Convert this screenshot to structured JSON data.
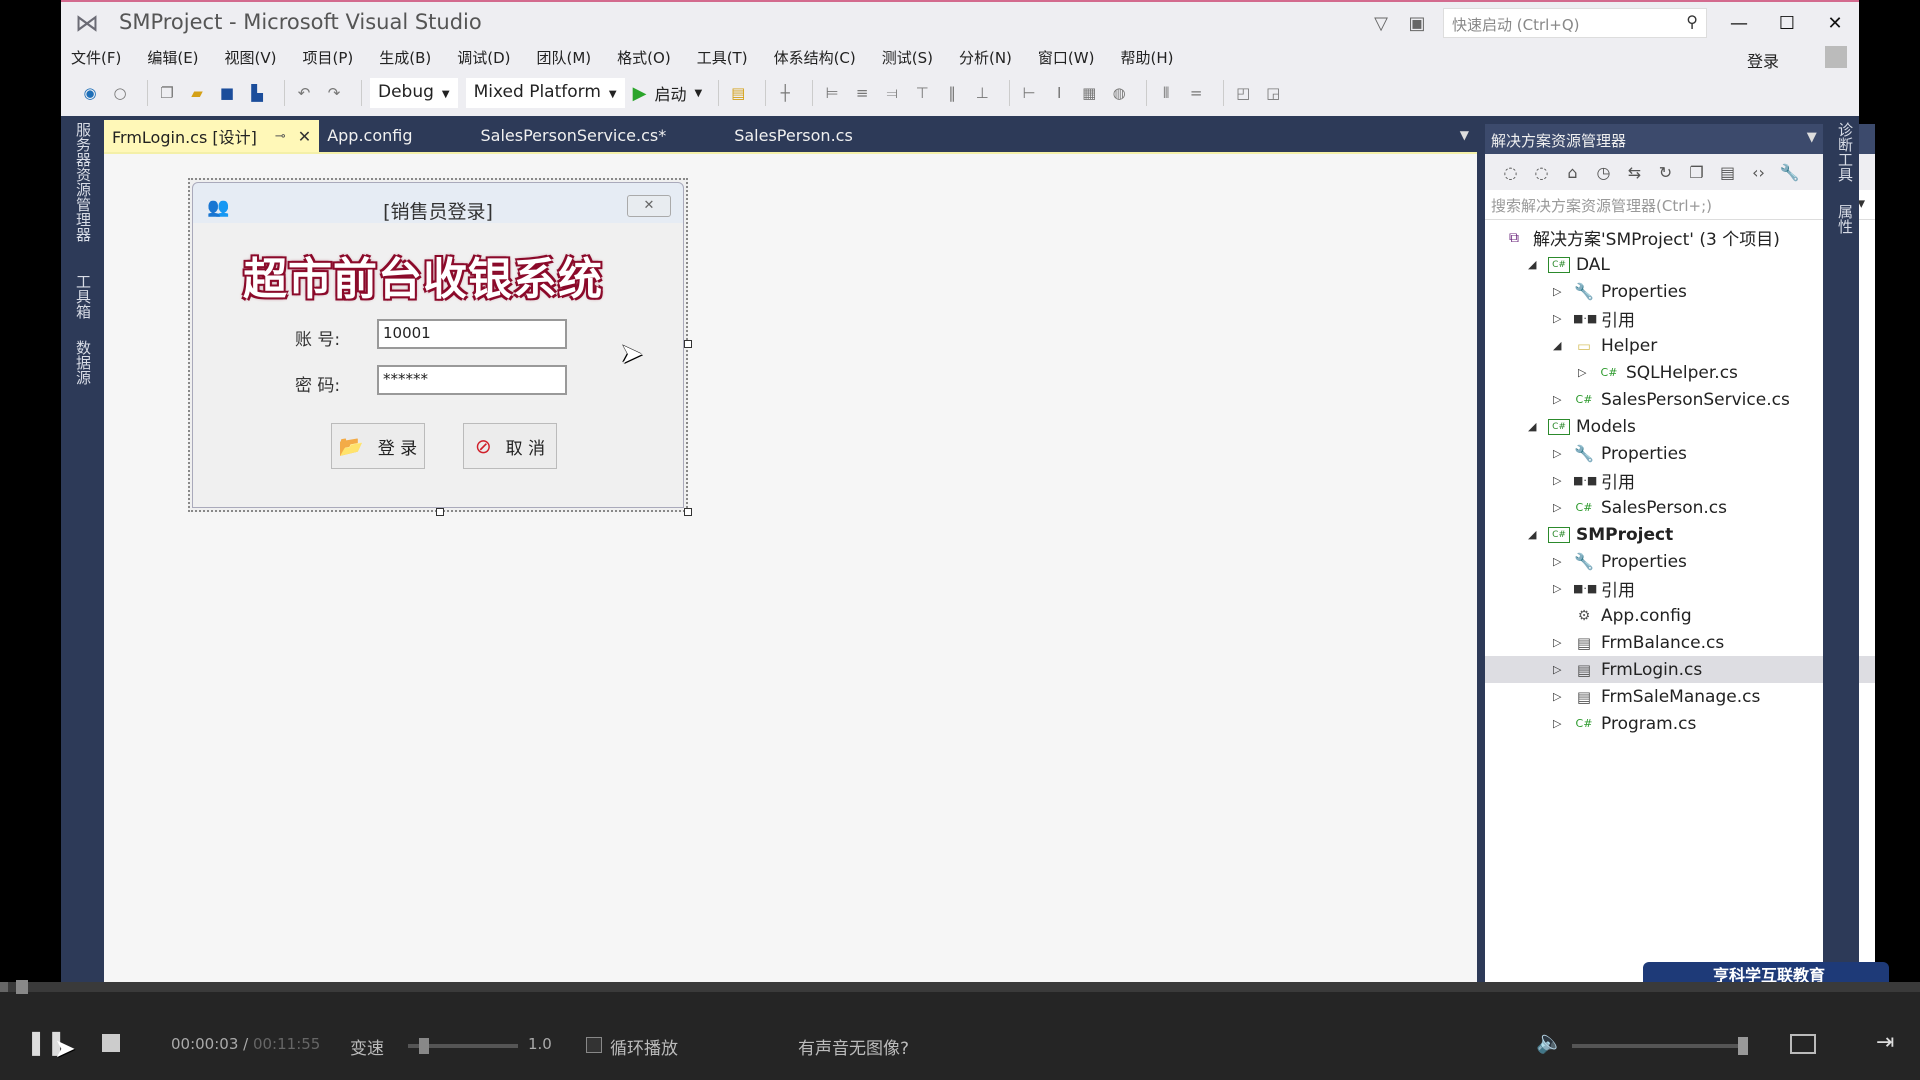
{
  "window": {
    "title": "SMProject - Microsoft Visual Studio",
    "quick_launch_placeholder": "快速启动 (Ctrl+Q)",
    "login_label": "登录",
    "minimize": "—",
    "maximize": "☐",
    "close": "✕"
  },
  "menu": [
    "文件(F)",
    "编辑(E)",
    "视图(V)",
    "项目(P)",
    "生成(B)",
    "调试(D)",
    "团队(M)",
    "格式(O)",
    "工具(T)",
    "体系结构(C)",
    "测试(S)",
    "分析(N)",
    "窗口(W)",
    "帮助(H)"
  ],
  "toolbar": {
    "config": "Debug",
    "platform": "Mixed Platform",
    "start_label": "启动"
  },
  "left_tabs": [
    "服务器资源管理器",
    "工具箱",
    "数据源"
  ],
  "right_tabs": [
    "诊断工具",
    "属性"
  ],
  "doc_tabs": [
    {
      "label": "FrmLogin.cs [设计]",
      "active": true
    },
    {
      "label": "App.config",
      "active": false
    },
    {
      "label": "SalesPersonService.cs*",
      "active": false
    },
    {
      "label": "SalesPerson.cs",
      "active": false
    }
  ],
  "form": {
    "title": "[销售员登录]",
    "banner": "超市前台收银系统",
    "account_label": "账  号:",
    "account_value": "10001",
    "password_label": "密  码:",
    "password_value": "******",
    "login_button": "登 录",
    "cancel_button": "取 消"
  },
  "solution_explorer": {
    "title": "解决方案资源管理器",
    "search_placeholder": "搜索解决方案资源管理器(Ctrl+;)",
    "tree": [
      {
        "label": "解决方案'SMProject' (3 个项目)",
        "level": 0,
        "icon": "solution",
        "expander": ""
      },
      {
        "label": "DAL",
        "level": 1,
        "icon": "csproj",
        "expander": "◢"
      },
      {
        "label": "Properties",
        "level": 2,
        "icon": "wrench",
        "expander": "▷"
      },
      {
        "label": "引用",
        "level": 2,
        "icon": "reference",
        "expander": "▷"
      },
      {
        "label": "Helper",
        "level": 2,
        "icon": "folder",
        "expander": "◢"
      },
      {
        "label": "SQLHelper.cs",
        "level": 3,
        "icon": "cs",
        "expander": "▷"
      },
      {
        "label": "SalesPersonService.cs",
        "level": 2,
        "icon": "cs",
        "expander": "▷"
      },
      {
        "label": "Models",
        "level": 1,
        "icon": "csproj",
        "expander": "◢"
      },
      {
        "label": "Properties",
        "level": 2,
        "icon": "wrench",
        "expander": "▷"
      },
      {
        "label": "引用",
        "level": 2,
        "icon": "reference",
        "expander": "▷"
      },
      {
        "label": "SalesPerson.cs",
        "level": 2,
        "icon": "cs",
        "expander": "▷"
      },
      {
        "label": "SMProject",
        "level": 1,
        "icon": "csproj",
        "expander": "◢",
        "bold": true
      },
      {
        "label": "Properties",
        "level": 2,
        "icon": "wrench",
        "expander": "▷"
      },
      {
        "label": "引用",
        "level": 2,
        "icon": "reference",
        "expander": "▷"
      },
      {
        "label": "App.config",
        "level": 2,
        "icon": "config",
        "expander": ""
      },
      {
        "label": "FrmBalance.cs",
        "level": 2,
        "icon": "form",
        "expander": "▷"
      },
      {
        "label": "FrmLogin.cs",
        "level": 2,
        "icon": "form",
        "expander": "▷",
        "selected": true
      },
      {
        "label": "FrmSaleManage.cs",
        "level": 2,
        "icon": "form",
        "expander": "▷"
      },
      {
        "label": "Program.cs",
        "level": 2,
        "icon": "cs",
        "expander": "▷"
      }
    ]
  },
  "watermark": "亨科学互联教育",
  "player": {
    "current_time": "00:00:03",
    "total_time": "00:11:55",
    "speed_label": "变速",
    "speed_value": "1.0",
    "loop_label": "循环播放",
    "no_image_label": "有声音无图像?",
    "progress_fraction": 0.004,
    "speed_fraction": 0.1,
    "volume_fraction": 0.97
  },
  "colors": {
    "vs_chrome": "#eeeef2",
    "vs_dark": "#2d3a58",
    "active_tab": "#fff8b8",
    "banner_outline": "#8b0a2a"
  }
}
